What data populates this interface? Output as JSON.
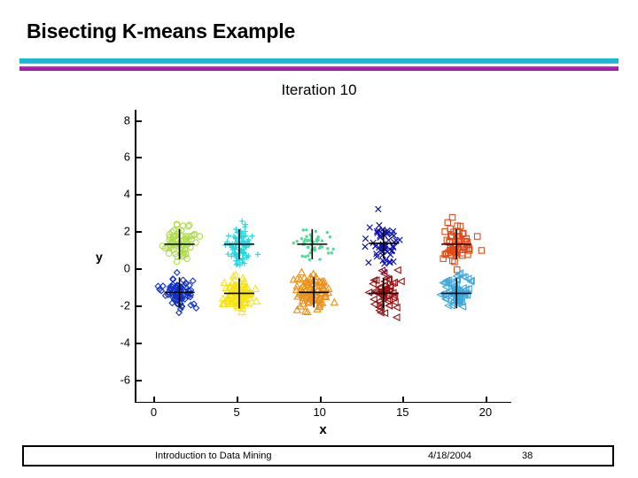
{
  "slide": {
    "title": "Bisecting K-means Example",
    "accent_cyan": "#1BB8D4",
    "accent_magenta": "#A719A7"
  },
  "footer": {
    "center": "Introduction to Data Mining",
    "date": "4/18/2004",
    "page": "38"
  },
  "chart_data": {
    "type": "scatter",
    "title": "Iteration 10",
    "xlabel": "x",
    "ylabel": "y",
    "xlim": [
      -1.2,
      21.5
    ],
    "ylim": [
      -7.2,
      8.6
    ],
    "xticks": [
      0,
      5,
      10,
      15,
      20
    ],
    "yticks": [
      8,
      6,
      4,
      2,
      0,
      -2,
      -4,
      -6
    ],
    "xticklabels": [
      "0",
      "5",
      "10",
      "15",
      "20"
    ],
    "yticklabels": [
      "8",
      "6",
      "4",
      "2",
      "0",
      "-2",
      "-4",
      "-6"
    ],
    "grid": false,
    "legend": null,
    "centroid_marker": "black-cross",
    "clusters": [
      {
        "name": "cluster-1-yellowgreen-circle",
        "color": "#AEDD4A",
        "marker": "circle",
        "centroid": [
          1.5,
          1.35
        ],
        "spread": [
          0.75,
          0.75
        ],
        "n": 70
      },
      {
        "name": "cluster-2-blue-diamond",
        "color": "#1030C8",
        "marker": "diamond",
        "centroid": [
          1.5,
          -1.25
        ],
        "spread": [
          0.85,
          0.75
        ],
        "n": 80
      },
      {
        "name": "cluster-3-cyan-plus",
        "color": "#25D8E2",
        "marker": "plus",
        "centroid": [
          5.1,
          1.35
        ],
        "spread": [
          0.6,
          0.85
        ],
        "n": 85
      },
      {
        "name": "cluster-4-yellow-triangle",
        "color": "#F7E314",
        "marker": "triangle-up",
        "centroid": [
          5.1,
          -1.3
        ],
        "spread": [
          0.8,
          0.75
        ],
        "n": 85
      },
      {
        "name": "cluster-5-springgreen-dot",
        "color": "#57D99A",
        "marker": "dot",
        "centroid": [
          9.5,
          1.35
        ],
        "spread": [
          0.8,
          0.75
        ],
        "n": 50
      },
      {
        "name": "cluster-6-orange-triangle",
        "color": "#E8901A",
        "marker": "triangle-up",
        "centroid": [
          9.6,
          -1.25
        ],
        "spread": [
          0.85,
          0.8
        ],
        "n": 85
      },
      {
        "name": "cluster-7-navy-x",
        "color": "#0E12A8",
        "marker": "x",
        "centroid": [
          13.8,
          1.4
        ],
        "spread": [
          0.75,
          0.95
        ],
        "n": 55
      },
      {
        "name": "cluster-8-darkred-triangle-left",
        "color": "#9A1010",
        "marker": "triangle-left",
        "centroid": [
          13.8,
          -1.3
        ],
        "spread": [
          0.7,
          0.95
        ],
        "n": 60
      },
      {
        "name": "cluster-9-red-square",
        "color": "#E24A18",
        "marker": "square",
        "centroid": [
          18.2,
          1.35
        ],
        "spread": [
          0.75,
          0.85
        ],
        "n": 65
      },
      {
        "name": "cluster-10-lightblue-triangle-left",
        "color": "#3BA8DC",
        "marker": "triangle-left",
        "centroid": [
          18.2,
          -1.3
        ],
        "spread": [
          0.75,
          0.9
        ],
        "n": 70
      }
    ]
  }
}
